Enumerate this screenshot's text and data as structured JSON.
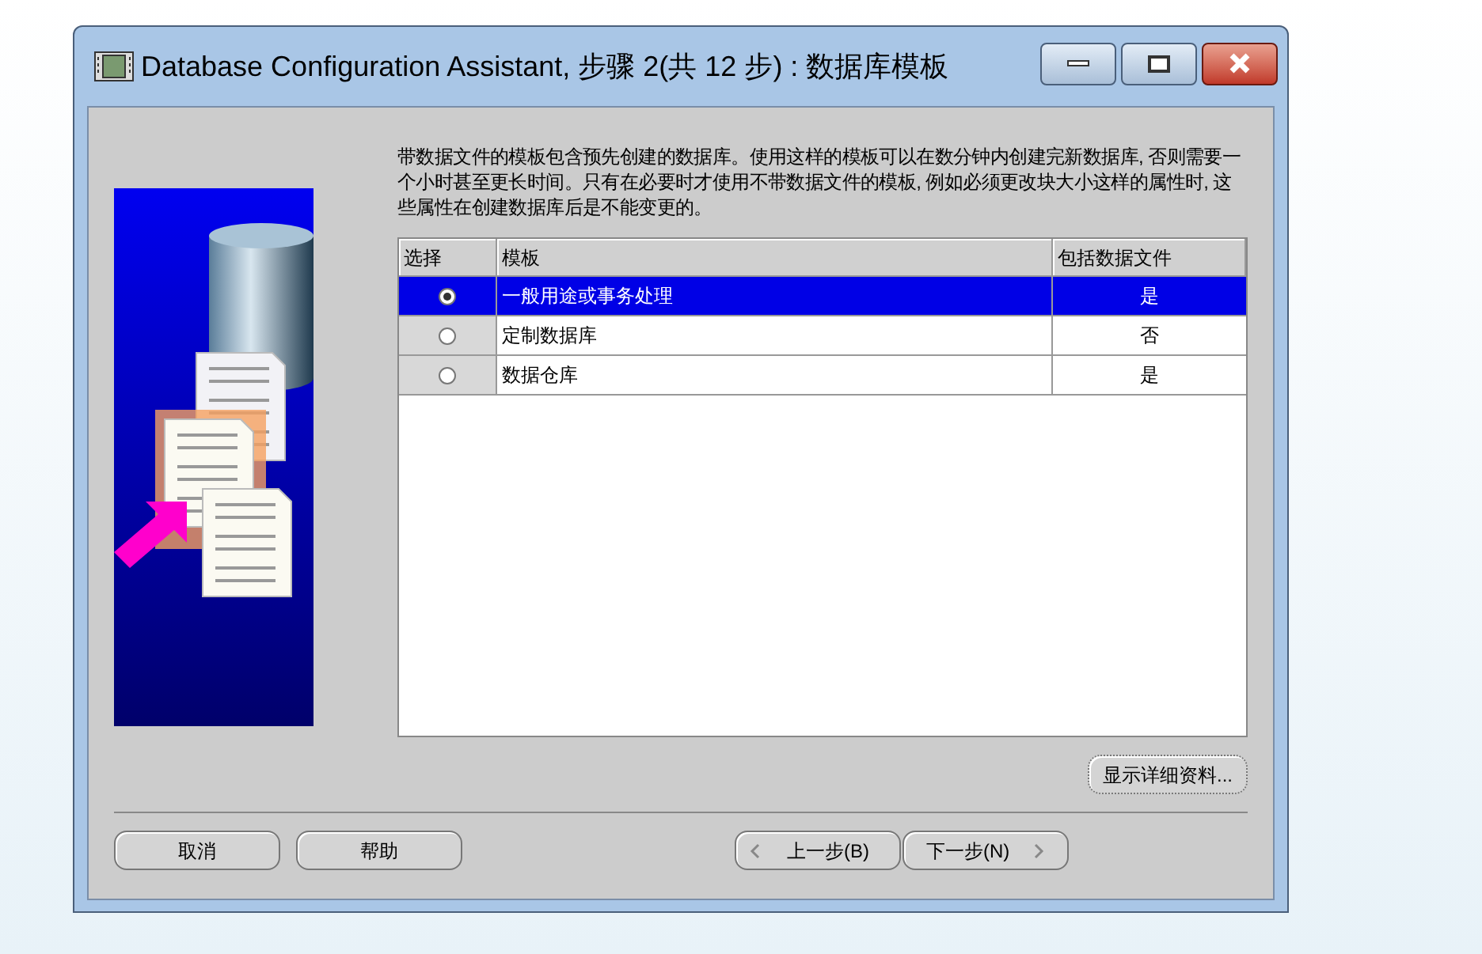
{
  "window": {
    "title": "Database Configuration Assistant, 步骤 2(共 12 步) : 数据库模板"
  },
  "description": "带数据文件的模板包含预先创建的数据库。使用这样的模板可以在数分钟内创建完新数据库, 否则需要一个小时甚至更长时间。只有在必要时才使用不带数据文件的模板, 例如必须更改块大小这样的属性时, 这些属性在创建数据库后是不能变更的。",
  "table": {
    "columns": [
      "选择",
      "模板",
      "包括数据文件"
    ],
    "rows": [
      {
        "template": "一般用途或事务处理",
        "includes_datafiles": "是",
        "selected": true
      },
      {
        "template": "定制数据库",
        "includes_datafiles": "否",
        "selected": false
      },
      {
        "template": "数据仓库",
        "includes_datafiles": "是",
        "selected": false
      }
    ]
  },
  "details_button": "显示详细资料...",
  "footer": {
    "cancel": "取消",
    "help": "帮助",
    "back": "上一步(B)",
    "next": "下一步(N)"
  }
}
